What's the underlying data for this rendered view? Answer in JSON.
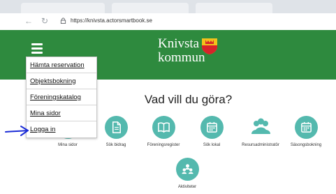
{
  "browser": {
    "url": "https://knivsta.actorsmartbook.se"
  },
  "menu": {
    "items": [
      {
        "label": "Hämta reservation"
      },
      {
        "label": "Objektsbokning"
      },
      {
        "label": "Föreningskatalog"
      },
      {
        "label": "Mina sidor"
      },
      {
        "label": "Logga in"
      }
    ]
  },
  "header": {
    "logo_line1": "Knivsta",
    "logo_line2": "kommun"
  },
  "main": {
    "heading": "Vad vill du göra?",
    "tiles": [
      {
        "label": "Mina sidor",
        "icon": "person-icon"
      },
      {
        "label": "Sök bidrag",
        "icon": "document-icon"
      },
      {
        "label": "Föreningsregister",
        "icon": "book-icon"
      },
      {
        "label": "Sök lokal",
        "icon": "calendar-icon"
      },
      {
        "label": "Resursadministratör",
        "icon": "group-icon"
      },
      {
        "label": "Säsongsbokning",
        "icon": "calendar-icon"
      },
      {
        "label": "Aktiviteter",
        "icon": "group-icon"
      }
    ]
  },
  "colors": {
    "header_green": "#2e8a3e",
    "tile_teal": "#54b9ae",
    "annotation_arrow": "#1a2bd6",
    "crest_yellow": "#f2c21b",
    "crest_red": "#d8232a"
  }
}
